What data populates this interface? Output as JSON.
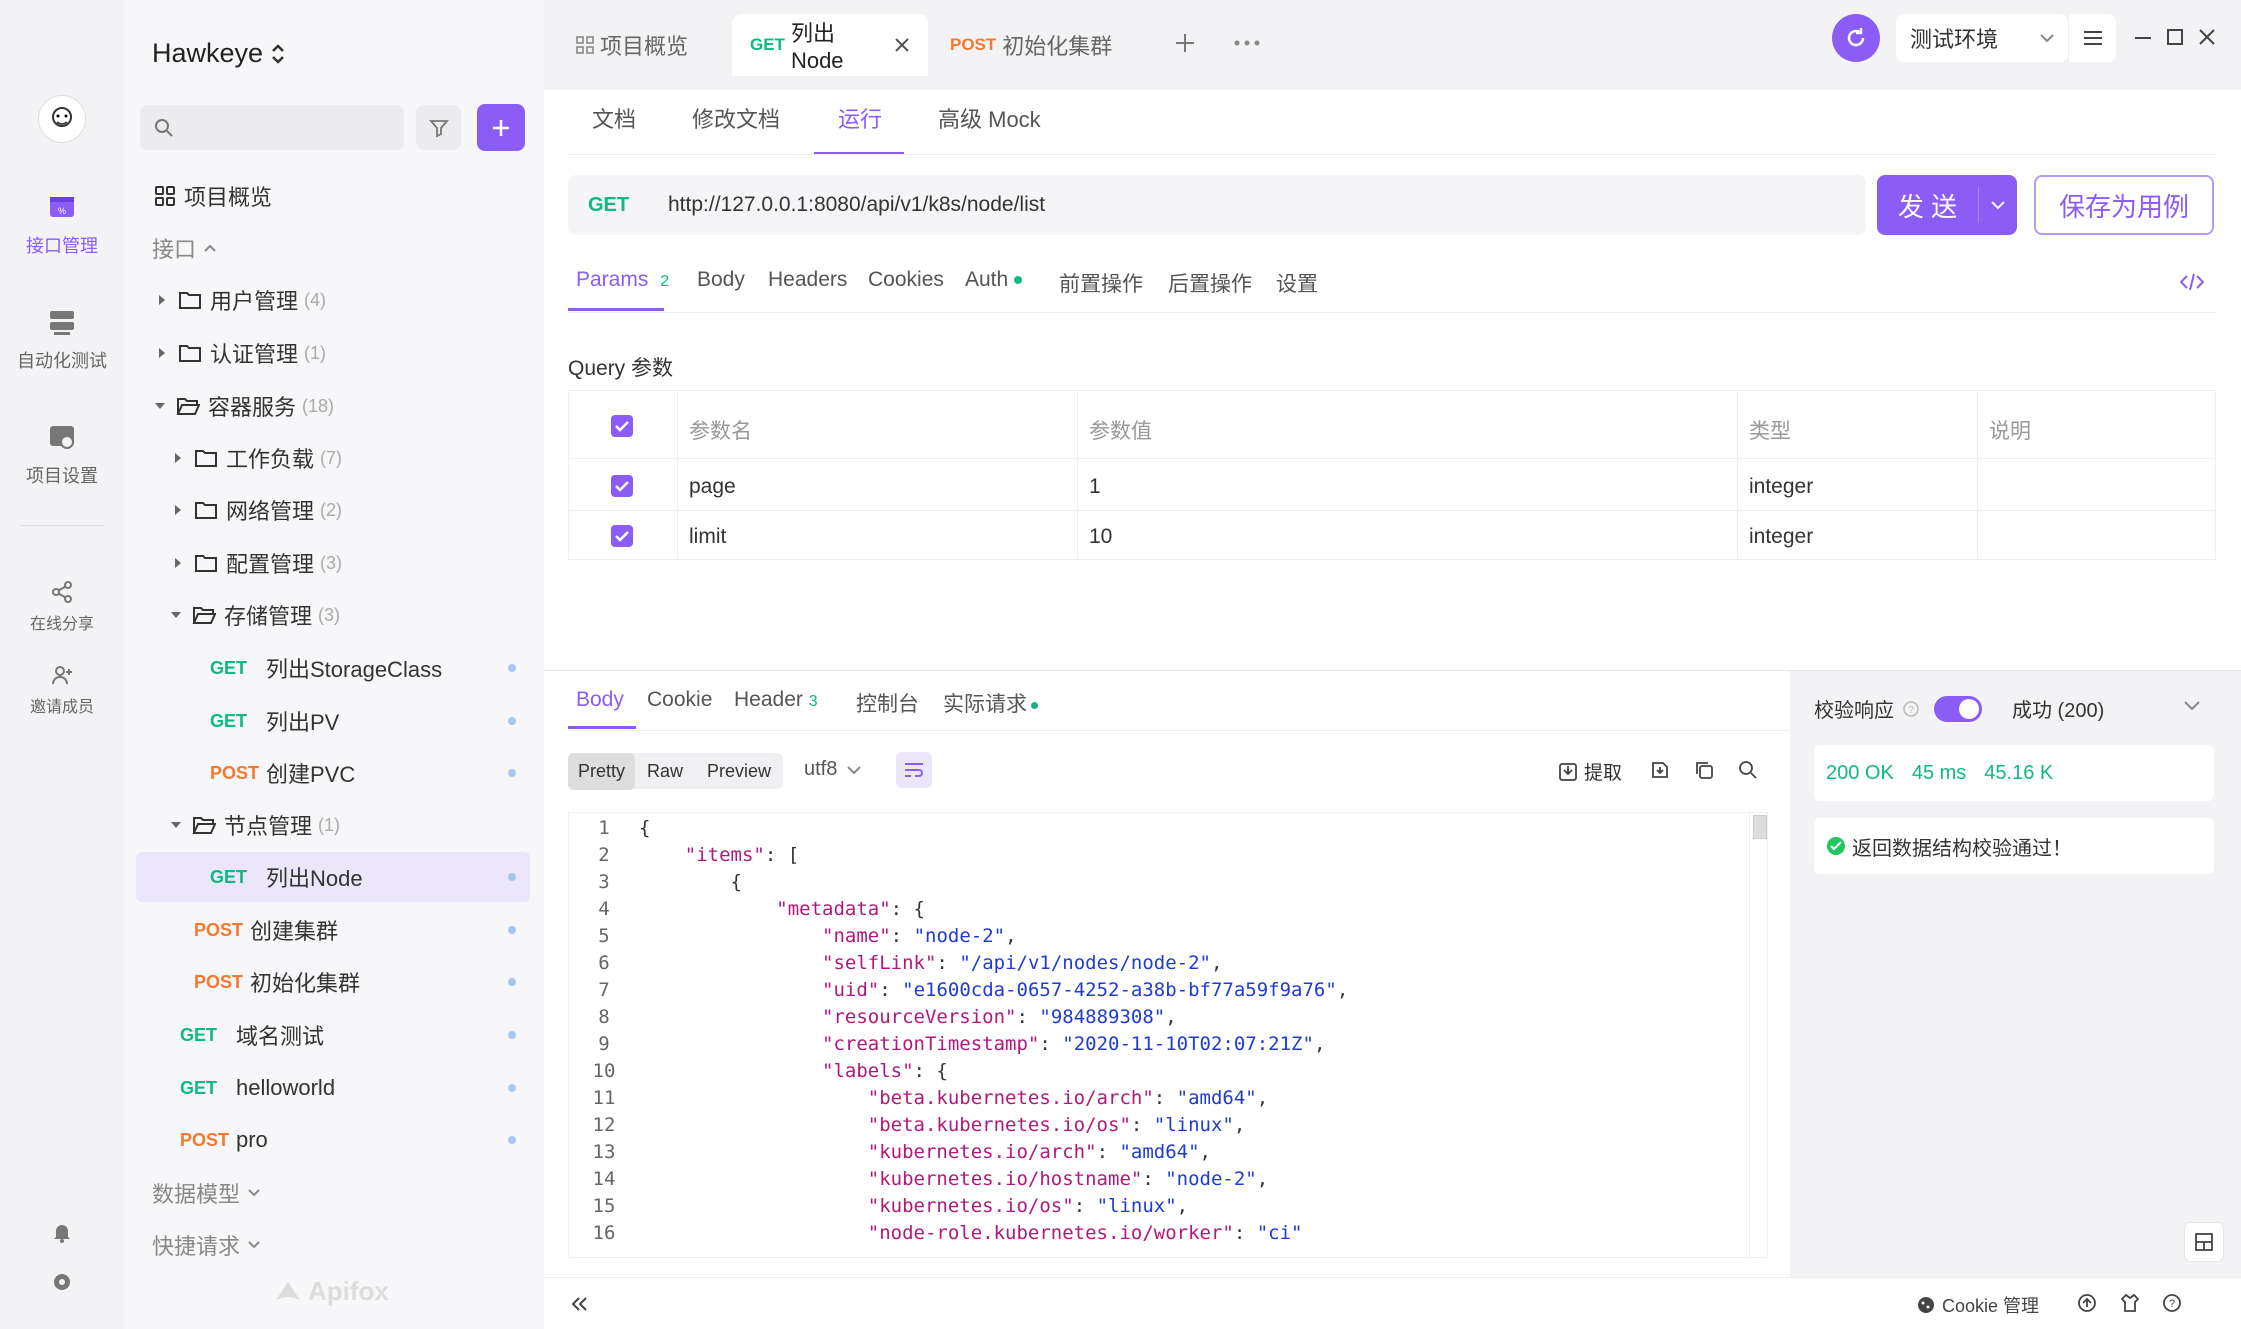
{
  "app": {
    "project_name": "Hawkeye",
    "watermark": "Apifox"
  },
  "rail": {
    "items": [
      {
        "label": "接口管理",
        "active": true
      },
      {
        "label": "自动化测试"
      },
      {
        "label": "项目设置"
      },
      {
        "label": "在线分享"
      },
      {
        "label": "邀请成员"
      }
    ]
  },
  "sidebar": {
    "overview": "项目概览",
    "section_api": "接口",
    "tree": [
      {
        "label": "用户管理",
        "count": "(4)"
      },
      {
        "label": "认证管理",
        "count": "(1)"
      },
      {
        "label": "容器服务",
        "count": "(18)"
      },
      {
        "label": "工作负载",
        "count": "(7)"
      },
      {
        "label": "网络管理",
        "count": "(2)"
      },
      {
        "label": "配置管理",
        "count": "(3)"
      },
      {
        "label": "存储管理",
        "count": "(3)"
      },
      {
        "method": "GET",
        "label": "列出StorageClass"
      },
      {
        "method": "GET",
        "label": "列出PV"
      },
      {
        "method": "POST",
        "label": "创建PVC"
      },
      {
        "label": "节点管理",
        "count": "(1)"
      },
      {
        "method": "GET",
        "label": "列出Node"
      },
      {
        "method": "POST",
        "label": "创建集群"
      },
      {
        "method": "POST",
        "label": "初始化集群"
      },
      {
        "method": "GET",
        "label": "域名测试"
      },
      {
        "method": "GET",
        "label": "helloworld"
      },
      {
        "method": "POST",
        "label": "pro"
      }
    ],
    "section_models": "数据模型",
    "section_quick": "快捷请求"
  },
  "tabs": [
    {
      "label": "项目概览"
    },
    {
      "method": "GET",
      "label": "列出Node"
    },
    {
      "method": "POST",
      "label": "初始化集群"
    }
  ],
  "env": {
    "label": "测试环境"
  },
  "subtabs": [
    "文档",
    "修改文档",
    "运行",
    "高级 Mock"
  ],
  "request": {
    "method": "GET",
    "url": "http://127.0.0.1:8080/api/v1/k8s/node/list",
    "send_label": "发 送",
    "save_label": "保存为用例"
  },
  "param_tabs": {
    "params": "Params",
    "params_count": "2",
    "body": "Body",
    "headers": "Headers",
    "cookies": "Cookies",
    "auth": "Auth",
    "pre": "前置操作",
    "post": "后置操作",
    "settings": "设置"
  },
  "query": {
    "title": "Query 参数",
    "headers": [
      "参数名",
      "参数值",
      "类型",
      "说明"
    ],
    "rows": [
      {
        "name": "page",
        "value": "1",
        "type": "integer"
      },
      {
        "name": "limit",
        "value": "10",
        "type": "integer"
      }
    ]
  },
  "response_tabs": {
    "body": "Body",
    "cookie": "Cookie",
    "header": "Header",
    "header_count": "3",
    "console": "控制台",
    "actual": "实际请求"
  },
  "view": {
    "pretty": "Pretty",
    "raw": "Raw",
    "preview": "Preview",
    "encoding": "utf8",
    "extract": "提取"
  },
  "code": [
    {
      "n": "1",
      "t": "{"
    },
    {
      "n": "2",
      "t": "    \"items\": ["
    },
    {
      "n": "3",
      "t": "        {"
    },
    {
      "n": "4",
      "t": "            \"metadata\": {"
    },
    {
      "n": "5",
      "t": "                \"name\": \"node-2\","
    },
    {
      "n": "6",
      "t": "                \"selfLink\": \"/api/v1/nodes/node-2\","
    },
    {
      "n": "7",
      "t": "                \"uid\": \"e1600cda-0657-4252-a38b-bf77a59f9a76\","
    },
    {
      "n": "8",
      "t": "                \"resourceVersion\": \"984889308\","
    },
    {
      "n": "9",
      "t": "                \"creationTimestamp\": \"2020-11-10T02:07:21Z\","
    },
    {
      "n": "10",
      "t": "                \"labels\": {"
    },
    {
      "n": "11",
      "t": "                    \"beta.kubernetes.io/arch\": \"amd64\","
    },
    {
      "n": "12",
      "t": "                    \"beta.kubernetes.io/os\": \"linux\","
    },
    {
      "n": "13",
      "t": "                    \"kubernetes.io/arch\": \"amd64\","
    },
    {
      "n": "14",
      "t": "                    \"kubernetes.io/hostname\": \"node-2\","
    },
    {
      "n": "15",
      "t": "                    \"kubernetes.io/os\": \"linux\","
    },
    {
      "n": "16",
      "t": "                    \"node-role.kubernetes.io/worker\": \"ci\""
    }
  ],
  "validation": {
    "label": "校验响应",
    "status": "成功 (200)",
    "ok": "200 OK",
    "time": "45 ms",
    "size": "45.16 K",
    "msg": "返回数据结构校验通过！"
  },
  "footer": {
    "cookie": "Cookie 管理"
  }
}
